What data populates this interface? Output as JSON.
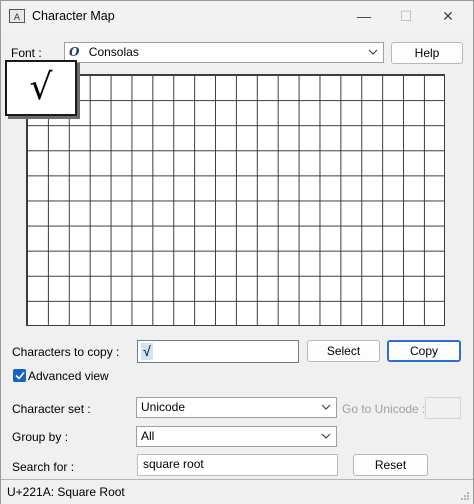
{
  "window": {
    "title": "Character Map",
    "controls": {
      "minimize": "—",
      "maximize": "☐",
      "close": "✕"
    }
  },
  "font_row": {
    "label": "Font :",
    "selected_font": "Consolas",
    "font_type_glyph": "O",
    "help_button": "Help"
  },
  "grid": {
    "enlarged_character": "√"
  },
  "copy_row": {
    "label": "Characters to copy :",
    "value": "√",
    "select_button": "Select",
    "copy_button": "Copy"
  },
  "advanced_view": {
    "label": "Advanced view",
    "checked": true
  },
  "character_set": {
    "label": "Character set :",
    "value": "Unicode",
    "goto_label": "Go to Unicode :"
  },
  "group_by": {
    "label": "Group by :",
    "value": "All"
  },
  "search": {
    "label": "Search for :",
    "value": "square root",
    "reset_button": "Reset"
  },
  "status_bar": {
    "text": "U+221A: Square Root"
  }
}
